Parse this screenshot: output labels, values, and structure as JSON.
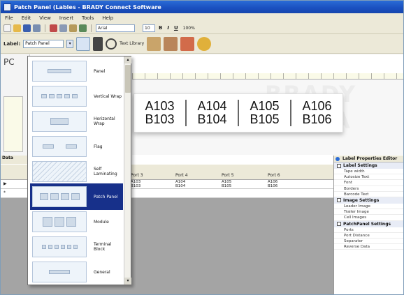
{
  "window": {
    "title": "Patch Panel (Lables - BRADY Connect Software"
  },
  "menu": [
    "File",
    "Edit",
    "View",
    "Insert",
    "Tools",
    "Help"
  ],
  "toolbar": {
    "font_name": "Arial",
    "font_size": "10",
    "bold": "B",
    "italic": "I",
    "underline": "U",
    "zoom": "100%"
  },
  "label_bar": {
    "caption": "Label:",
    "type_value": "Patch Panel",
    "text_library": "Text Library"
  },
  "workspace": {
    "pc_label": "PC",
    "watermark": "BRADY CHINA"
  },
  "label_preview": {
    "ports": [
      {
        "top": "A103",
        "bottom": "B103"
      },
      {
        "top": "A104",
        "bottom": "B104"
      },
      {
        "top": "A105",
        "bottom": "B105"
      },
      {
        "top": "A106",
        "bottom": "B106"
      }
    ]
  },
  "panel_caption": "Data",
  "grid": {
    "columns": [
      "Port 3",
      "Port 4",
      "Port 5",
      "Port 6"
    ],
    "rows": [
      {
        "marker": "▶",
        "cells": [
          [
            "A103",
            "B103"
          ],
          [
            "A104",
            "B104"
          ],
          [
            "A105",
            "B105"
          ],
          [
            "A106",
            "B106"
          ]
        ]
      },
      {
        "marker": "*",
        "cells": []
      }
    ]
  },
  "properties": {
    "title": "Label Properties Editor",
    "sections": [
      {
        "name": "Label Settings",
        "rows": [
          "Tape width",
          "Autosize Text",
          "Font",
          "Borders",
          "Barcode Text"
        ]
      },
      {
        "name": "Image Settings",
        "rows": [
          "Leader Image",
          "Trailer Image",
          "Cell Images"
        ]
      },
      {
        "name": "PatchPanel Settings",
        "rows": [
          "Ports",
          "Port Distance",
          "Separator",
          "Reverse Data"
        ]
      }
    ]
  },
  "dropdown": {
    "items": [
      {
        "label": "Panel",
        "selected": false
      },
      {
        "label": "Vertical Wrap",
        "selected": false
      },
      {
        "label": "Horizontal Wrap",
        "selected": false
      },
      {
        "label": "Flag",
        "selected": false
      },
      {
        "label": "Self Laminating",
        "selected": false
      },
      {
        "label": "Patch Panel",
        "selected": true
      },
      {
        "label": "Module",
        "selected": false
      },
      {
        "label": "Terminal Block",
        "selected": false
      },
      {
        "label": "General",
        "selected": false
      }
    ]
  },
  "colors": {
    "titlebar": "#1a4fbf",
    "selection": "#17308a",
    "chrome": "#ece9d8"
  }
}
